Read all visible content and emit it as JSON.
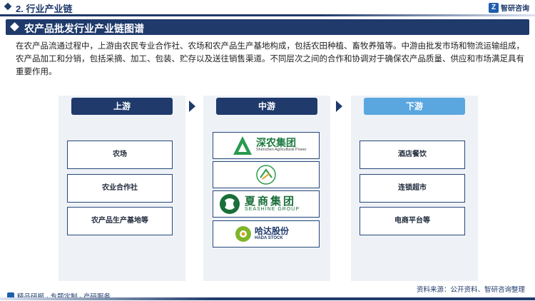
{
  "header": {
    "section_title": "2. 行业产业链",
    "brand": "智研咨询"
  },
  "banner": {
    "title": "农产品批发行业产业链图谱"
  },
  "intro": "在农产品流通过程中，上游由农民专业合作社、农场和农产品生产基地构成，包括农田种植、畜牧养殖等。中游由批发市场和物流运输组成，农产品加工和分销，包括采摘、加工、包装、贮存以及送往销售渠道。不同层次之间的合作和协调对于确保农产品质量、供应和市场满足具有重要作用。",
  "columns": {
    "upstream": {
      "label": "上游",
      "items": [
        "农场",
        "农业合作社",
        "农产品生产基地等"
      ]
    },
    "midstream": {
      "label": "中游",
      "logos": [
        {
          "name": "深农集团",
          "sub": "Shenzhen Agricultural Power"
        },
        {
          "name": "",
          "sub": ""
        },
        {
          "name": "夏商集团",
          "sub": "SEASHINE GROUP"
        },
        {
          "name": "哈达股份",
          "sub": "HADA STOCK"
        }
      ]
    },
    "downstream": {
      "label": "下游",
      "items": [
        "酒店餐饮",
        "连锁超市",
        "电商平台等"
      ]
    }
  },
  "footer": {
    "left": "精品研报 · 专题定制 · 产研服务",
    "source": "资料来源：公开资料、智研咨询整理"
  },
  "colors": {
    "navy": "#1f3a6b",
    "light_blue": "#5aa7e0",
    "panel": "#eef2f7"
  }
}
